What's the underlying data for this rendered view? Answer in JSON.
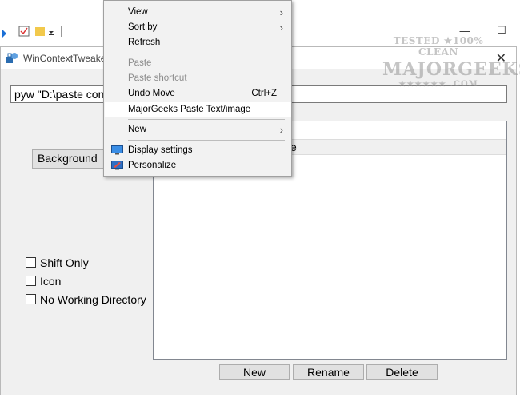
{
  "app": {
    "title": "WinContextTweaker",
    "close_glyph": "✕"
  },
  "command": {
    "value": "pyw \"D:\\paste conte"
  },
  "location_select": {
    "value": "Background"
  },
  "list": {
    "partial_entry": "e"
  },
  "options": [
    {
      "label": "Shift Only"
    },
    {
      "label": "Icon"
    },
    {
      "label": "No Working Directory"
    }
  ],
  "buttons": {
    "new": "New",
    "rename": "Rename",
    "delete": "Delete"
  },
  "context_menu": {
    "view": "View",
    "sort_by": "Sort by",
    "refresh": "Refresh",
    "paste": "Paste",
    "paste_shortcut": "Paste shortcut",
    "undo_move": "Undo Move",
    "undo_shortcut": "Ctrl+Z",
    "majorgeeks": "MajorGeeks Paste Text/image",
    "new": "New",
    "display_settings": "Display settings",
    "personalize": "Personalize"
  },
  "window_controls": {
    "minimize": "—",
    "maximize": "☐"
  },
  "watermark": {
    "line1": "TESTED ★100% CLEAN",
    "line2": "MAJORGEEKS",
    "line3": "★★★★★★ .COM"
  },
  "colors": {
    "accent": "#1a6fd6",
    "menu_bg": "#f2f2f2",
    "disabled_text": "#8c8c8c"
  }
}
